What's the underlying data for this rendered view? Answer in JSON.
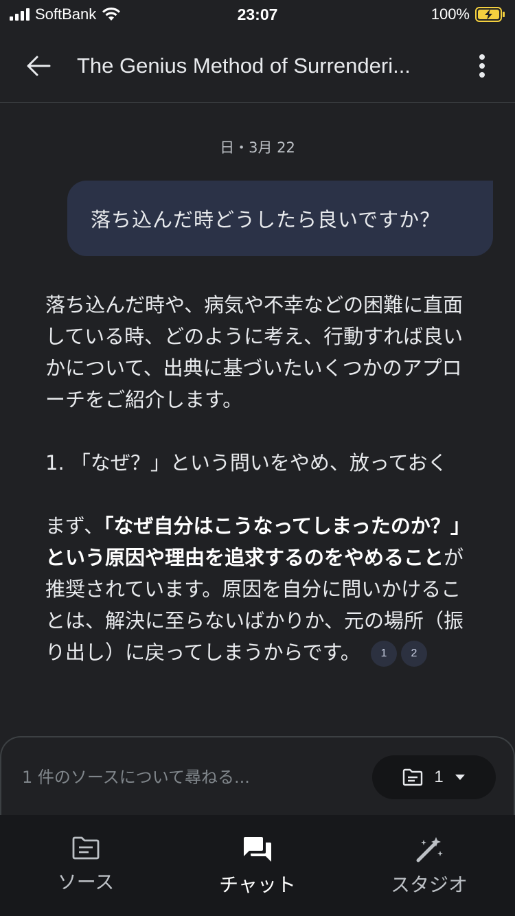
{
  "status_bar": {
    "carrier": "SoftBank",
    "time": "23:07",
    "battery": "100%"
  },
  "app_bar": {
    "title": "The Genius Method of Surrenderi..."
  },
  "chat": {
    "date": "日・3月 22",
    "user_message": "落ち込んだ時どうしたら良いですか？",
    "reply": {
      "intro": "落ち込んだ時や、病気や不幸などの困難に直面している時、どのように考え、行動すれば良いかについて、出典に基づいたいくつかのアプローチをご紹介します。",
      "heading": "1. 「なぜ？」という問いをやめ、放っておく",
      "body_pre": "まず、",
      "body_bold": "「なぜ自分はこうなってしまったのか？」という原因や理由を追求するのをやめること",
      "body_post": "が推奨されています。原因を自分に問いかけることは、解決に至らないばかりか、元の場所（振り出し）に戻ってしまうからです。",
      "citations": [
        "1",
        "2"
      ]
    }
  },
  "input": {
    "placeholder": "1 件のソースについて尋ねる...",
    "source_count": "1"
  },
  "bottom_nav": [
    {
      "label": "ソース",
      "icon": "sources-icon"
    },
    {
      "label": "チャット",
      "icon": "chat-icon"
    },
    {
      "label": "スタジオ",
      "icon": "studio-icon"
    }
  ],
  "colors": {
    "background": "#202124",
    "user_bubble": "#2b3247",
    "nav_background": "#17181b",
    "battery_accent": "#f4d03f"
  }
}
